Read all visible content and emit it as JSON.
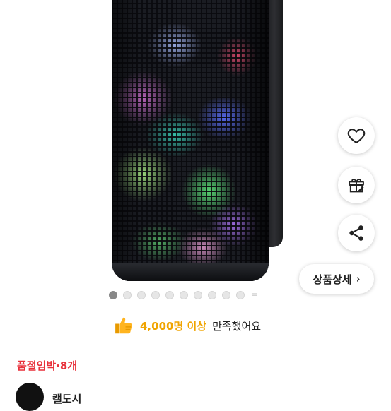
{
  "product": {
    "image_alt": "LED 블루투스 스피커",
    "gallery": {
      "dots": 10,
      "active_index": 0,
      "more_icon": "more-dots-icon"
    }
  },
  "actions": {
    "wishlist_icon": "heart-icon",
    "gift_icon": "gift-icon",
    "share_icon": "share-icon",
    "detail_label": "상품상세",
    "detail_chevron": "›"
  },
  "satisfaction": {
    "icon": "thumbs-up-icon",
    "count": "4,000명 이상",
    "text": "만족했어요"
  },
  "stock": {
    "label": "품절임박·8개"
  },
  "brand": {
    "name": "캘도시"
  },
  "colors": {
    "accent_orange": "#f0a400",
    "stock_red": "#e8303a"
  }
}
